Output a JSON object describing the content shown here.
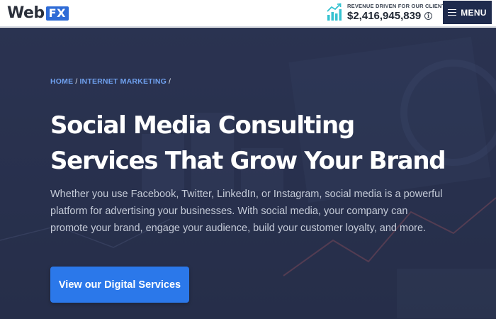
{
  "header": {
    "logo": {
      "word": "Web",
      "badge": "FX"
    },
    "revenue": {
      "label": "REVENUE DRIVEN FOR OUR CLIENTS",
      "amount": "$2,416,945,839",
      "info_glyph": "i",
      "icon": "growth-chart-icon"
    },
    "menu": {
      "label": "MENU",
      "icon": "hamburger-icon"
    }
  },
  "breadcrumb": {
    "items": [
      {
        "label": "HOME"
      },
      {
        "label": "INTERNET MARKETING"
      }
    ],
    "separator": "/"
  },
  "hero": {
    "title_lines": [
      "Social Media Consulting",
      "Services That Grow Your Brand"
    ],
    "description": "Whether you use Facebook, Twitter, LinkedIn, or Instagram, social media is a powerful platform for advertising your businesses. With social media, your company can promote your brand, engage your audience, build your customer loyalty, and more.",
    "cta_label": "View our Digital Services"
  },
  "colors": {
    "brand_blue": "#2e6bd6",
    "menu_navy": "#1f2b4d",
    "hero_bg": "#2b3452",
    "link_blue": "#6fa0ee",
    "cta_blue": "#2b78ea",
    "revenue_icon_teal": "#35c2d0"
  }
}
